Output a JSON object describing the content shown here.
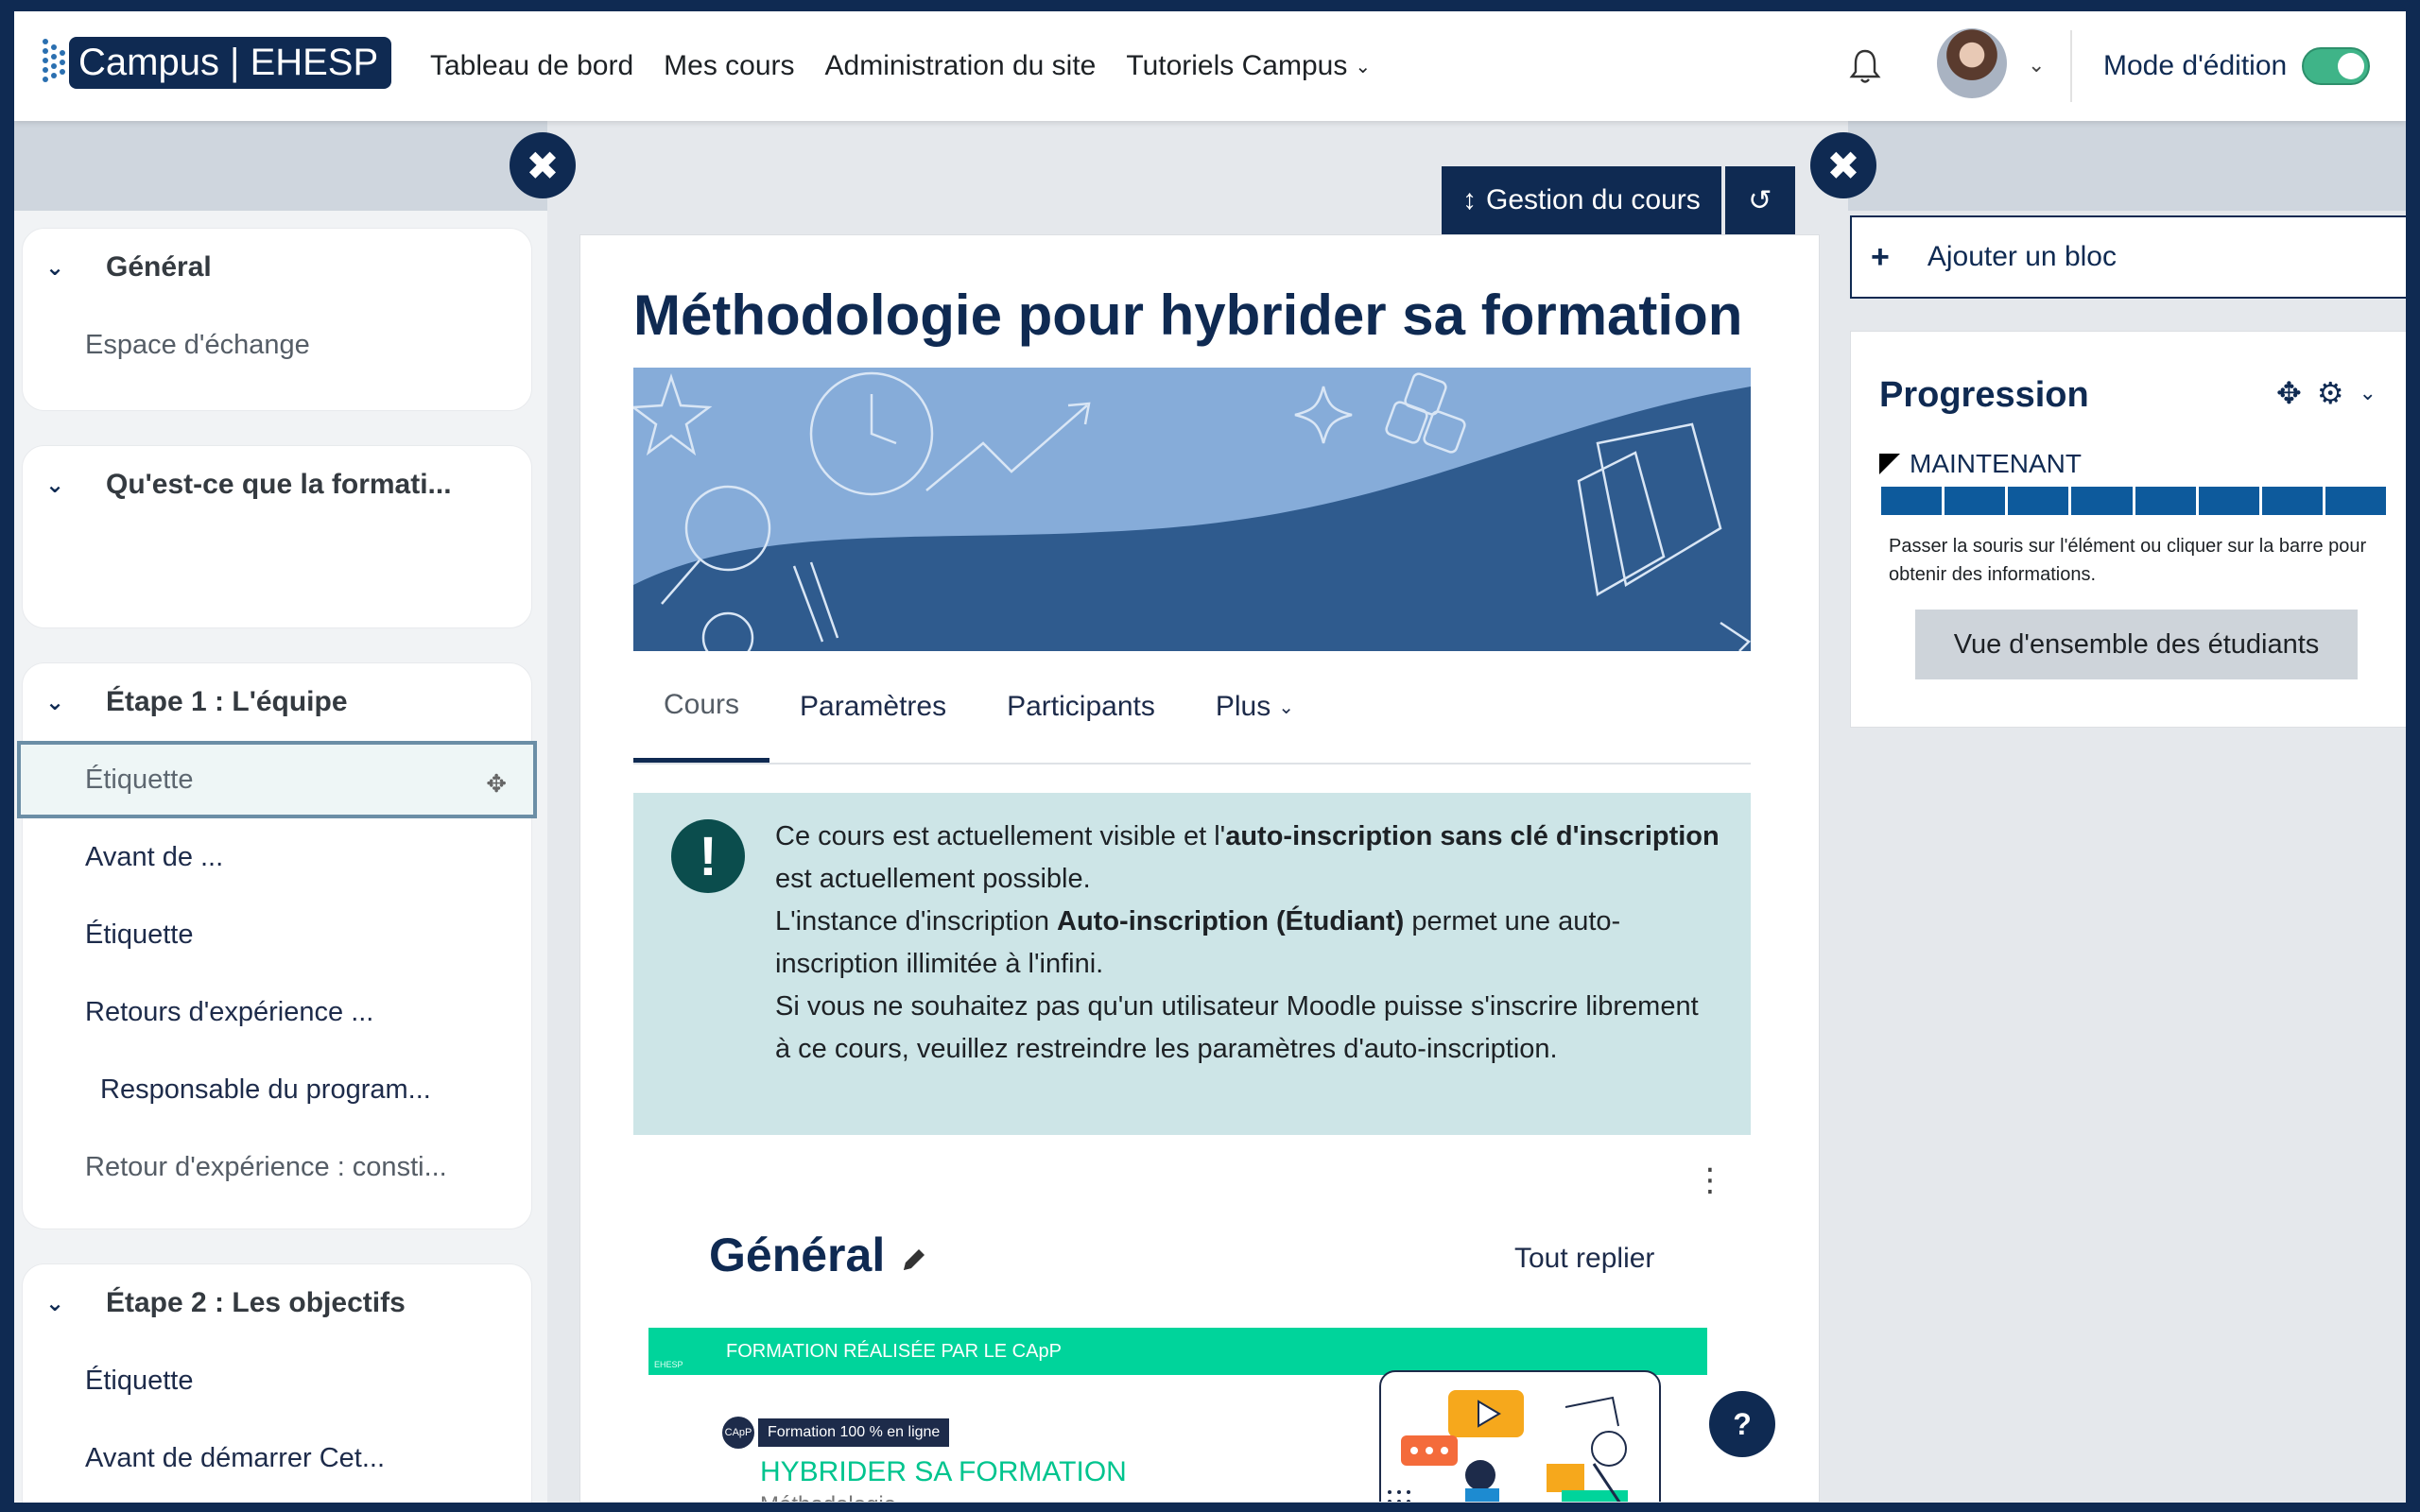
{
  "navbar": {
    "logo_text": "Campus | EHESP",
    "links": [
      {
        "label": "Tableau de bord"
      },
      {
        "label": "Mes cours"
      },
      {
        "label": "Administration du site"
      },
      {
        "label": "Tutoriels Campus"
      }
    ],
    "edit_mode_label": "Mode d'édition",
    "edit_mode_on": true
  },
  "course_index": {
    "sections": [
      {
        "title": "Général",
        "items": [
          "Espace d'échange"
        ]
      },
      {
        "title": "Qu'est-ce que la formati...",
        "items": []
      },
      {
        "title": "Étape 1 : L'équipe",
        "items": [
          "Étiquette",
          "Avant de  ...",
          "Étiquette",
          "Retours d'expérience ...",
          "Responsable du program...",
          "Retour d'expérience : consti..."
        ]
      },
      {
        "title": "Étape 2 : Les objectifs",
        "items": [
          "Étiquette",
          "Avant de démarrer Cet..."
        ]
      }
    ]
  },
  "main": {
    "course_management_label": "Gestion du cours",
    "course_title": "Méthodologie pour hybrider sa formation",
    "tabs": [
      {
        "label": "Cours"
      },
      {
        "label": "Paramètres"
      },
      {
        "label": "Participants"
      },
      {
        "label": "Plus"
      }
    ],
    "alert": {
      "p1_a": "Ce cours est actuellement visible et l'",
      "p1_b": "auto-inscription sans clé d'inscription",
      "p1_c": " est actuellement possible.",
      "p2_a": "L'instance d'inscription ",
      "p2_b": "Auto-inscription (Étudiant)",
      "p2_c": " permet une auto-inscription illimitée à l'infini.",
      "p3": "Si vous ne souhaitez pas qu'un utilisateur Moodle puisse s'inscrire librement à ce cours, veuillez restreindre les paramètres d'auto-inscription."
    },
    "section_title": "Général",
    "collapse_all_label": "Tout replier",
    "promo": {
      "bar_text": "FORMATION RÉALISÉE PAR LE CApP",
      "logo_text": "CApP",
      "badge": "Formation 100 % en ligne",
      "heading": "HYBRIDER SA FORMATION",
      "sub": "Méthodologie",
      "small_logo": "EHESP"
    }
  },
  "blocks": {
    "add_block_label": "Ajouter un bloc",
    "progress": {
      "title": "Progression",
      "now_label": "MAINTENANT",
      "segments": 8,
      "hint": "Passer la souris sur l'élément ou cliquer sur la barre pour obtenir des informations.",
      "overview_label": "Vue d'ensemble des étudiants"
    }
  },
  "help_label": "?",
  "colors": {
    "brand": "#0f2a52",
    "progress": "#0d5a9c",
    "alert_bg": "#cde5e7",
    "toggle": "#3fb488",
    "promo": "#00d49b"
  }
}
